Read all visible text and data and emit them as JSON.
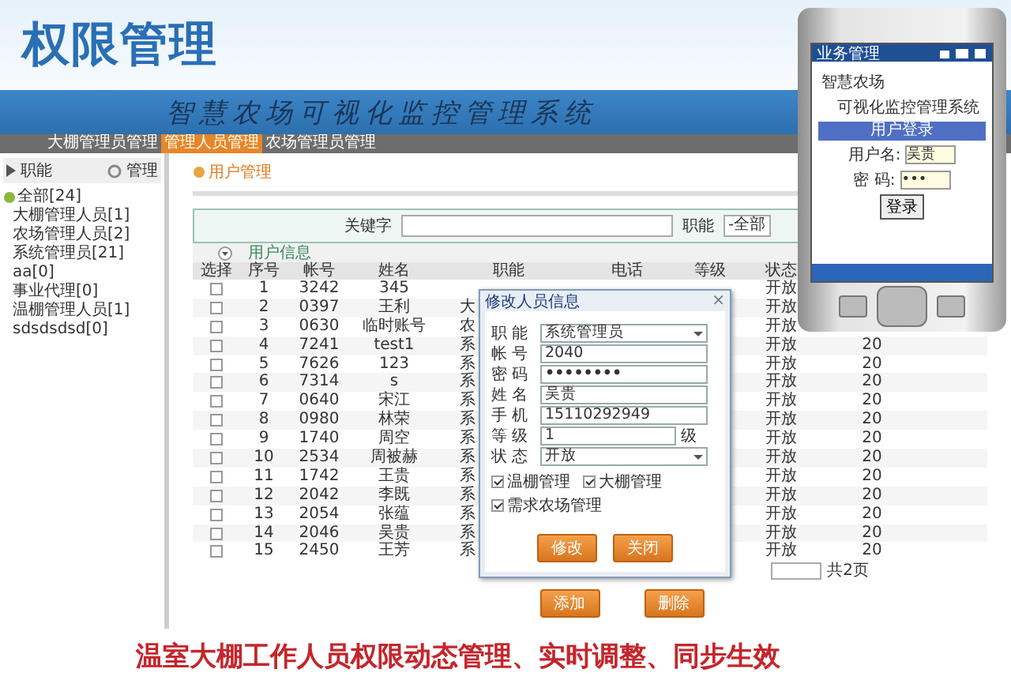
{
  "banner": {
    "title": "权限管理"
  },
  "system": {
    "title": "智慧农场可视化监控管理系统",
    "nav": [
      {
        "label": "大棚管理员管理",
        "selected": false
      },
      {
        "label": "管理人员管理",
        "selected": true
      },
      {
        "label": "农场管理员管理",
        "selected": false
      }
    ],
    "sidebar": {
      "heading": "职能",
      "action": "管理",
      "tree": [
        {
          "label": "全部[24]",
          "expanded": true,
          "children": [
            {
              "label": "大棚管理人员[1]"
            },
            {
              "label": "农场管理人员[2]"
            },
            {
              "label": "系统管理员[21]"
            },
            {
              "label": "aa[0]"
            },
            {
              "label": "事业代理[0]"
            },
            {
              "label": "温棚管理人员[1]"
            },
            {
              "label": "sdsdsdsd[0]"
            }
          ]
        }
      ]
    },
    "page_title": "用户管理",
    "search": {
      "label": "关键字",
      "filter_label": "职能",
      "filter_value": "-全部"
    },
    "section": "用户信息",
    "table": {
      "columns": [
        "选择",
        "序号",
        "帐号",
        "姓名",
        "职能",
        "电话",
        "等级",
        "状态"
      ],
      "rows": [
        {
          "selected": false,
          "no": "1",
          "account": "3242",
          "name": "345",
          "status": "开放"
        },
        {
          "selected": false,
          "no": "2",
          "account": "0397",
          "name": "王利",
          "role": "大",
          "status": "开放"
        },
        {
          "selected": false,
          "no": "3",
          "account": "0630",
          "name": "临时账号",
          "role": "农",
          "status": "开放"
        },
        {
          "selected": false,
          "no": "4",
          "account": "7241",
          "name": "test1",
          "role": "系",
          "status": "开放",
          "column_9": "20"
        },
        {
          "selected": false,
          "no": "5",
          "account": "7626",
          "name": "123",
          "role": "系",
          "status": "开放",
          "column_9": "20"
        },
        {
          "selected": false,
          "no": "6",
          "account": "7314",
          "name": "s",
          "role": "系",
          "status": "开放",
          "column_9": "20"
        },
        {
          "selected": false,
          "no": "7",
          "account": "0640",
          "name": "宋江",
          "role": "系",
          "status": "开放",
          "column_9": "20"
        },
        {
          "selected": false,
          "no": "8",
          "account": "0980",
          "name": "林荣",
          "role": "系",
          "status": "开放",
          "column_9": "20"
        },
        {
          "selected": false,
          "no": "9",
          "account": "1740",
          "name": "周空",
          "role": "系",
          "status": "开放",
          "column_9": "20"
        },
        {
          "selected": false,
          "no": "10",
          "account": "2534",
          "name": "周被赫",
          "role": "系",
          "status": "开放",
          "column_9": "20"
        },
        {
          "selected": false,
          "no": "11",
          "account": "1742",
          "name": "王贵",
          "role": "系",
          "status": "开放",
          "column_9": "20"
        },
        {
          "selected": false,
          "no": "12",
          "account": "2042",
          "name": "李既",
          "role": "系",
          "status": "开放",
          "column_9": "20"
        },
        {
          "selected": false,
          "no": "13",
          "account": "2054",
          "name": "张蕴",
          "role": "系",
          "status": "开放",
          "column_9": "20"
        },
        {
          "selected": false,
          "no": "14",
          "account": "2046",
          "name": "吴贵",
          "role": "系",
          "status": "开放",
          "column_9": "20"
        },
        {
          "selected": false,
          "no": "15",
          "account": "2450",
          "name": "王芳",
          "role": "系",
          "status": "开放",
          "column_9": "20"
        }
      ]
    },
    "pagination": "共2页",
    "buttons": [
      "添加",
      "删除"
    ],
    "dialog": {
      "title": "修改人员信息",
      "close": "×",
      "fields": [
        {
          "label": "职 能",
          "value": "系统管理员",
          "kind": "select"
        },
        {
          "label": "帐 号",
          "value": "2040",
          "kind": "text"
        },
        {
          "label": "密 码",
          "value": "••••••••",
          "kind": "password"
        },
        {
          "label": "姓 名",
          "value": "吴贵",
          "kind": "text"
        },
        {
          "label": "手 机",
          "value": "15110292949",
          "kind": "text"
        },
        {
          "label": "等 级",
          "value": "1",
          "kind": "text",
          "suffix": "级"
        },
        {
          "label": "状 态",
          "value": "开放",
          "kind": "select"
        }
      ],
      "permissions": [
        {
          "label": "温棚管理",
          "checked": true
        },
        {
          "label": "大棚管理",
          "checked": true
        },
        {
          "label": "需求农场管理",
          "checked": true
        }
      ],
      "buttons": [
        "修改",
        "关闭"
      ]
    }
  },
  "phone": {
    "status_title": "业务管理",
    "heading": [
      "智慧农场",
      "可视化监控管理系统"
    ],
    "band": "用户登录",
    "fields": [
      {
        "label": "用户名:",
        "value": "吴贵"
      },
      {
        "label": "密 码:",
        "value": "•••"
      }
    ],
    "button": "登录"
  },
  "caption": "温室大棚工作人员权限动态管理、实时调整、同步生效"
}
